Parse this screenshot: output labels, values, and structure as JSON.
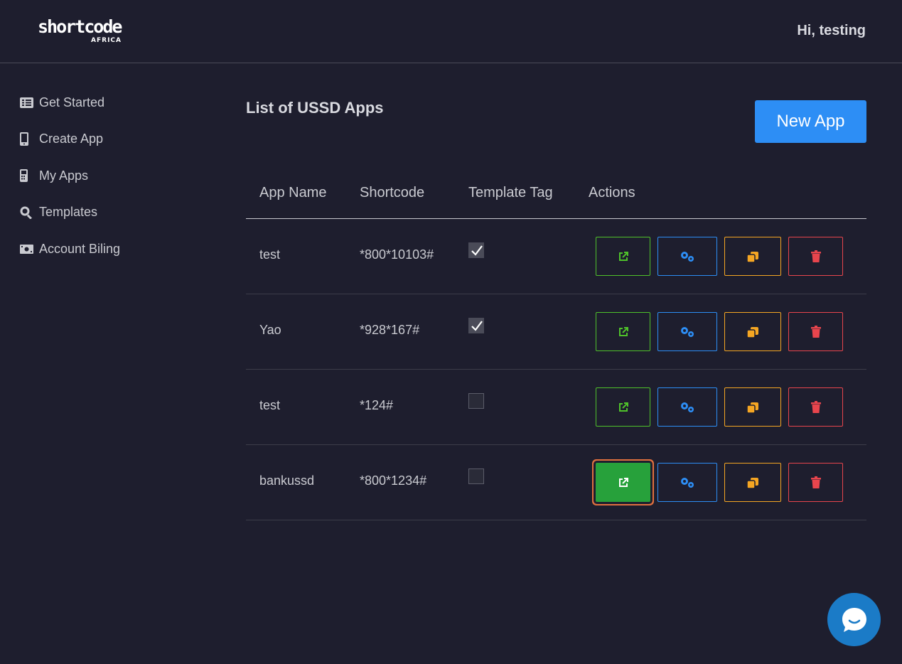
{
  "brand": {
    "logo_text": "shortcode",
    "logo_sub": "AFRICA"
  },
  "header": {
    "greeting": "Hi, testing"
  },
  "sidebar": {
    "items": [
      {
        "label": "Get Started",
        "icon": "list-icon"
      },
      {
        "label": "Create App",
        "icon": "mobile-icon"
      },
      {
        "label": "My Apps",
        "icon": "phone-icon"
      },
      {
        "label": "Templates",
        "icon": "search-icon"
      },
      {
        "label": "Account Biling",
        "icon": "money-icon"
      }
    ]
  },
  "main": {
    "title": "List of USSD Apps",
    "new_app_label": "New App",
    "columns": [
      "App Name",
      "Shortcode",
      "Template Tag",
      "Actions"
    ],
    "rows": [
      {
        "name": "test",
        "shortcode": "*800*10103#",
        "template": true
      },
      {
        "name": "Yao",
        "shortcode": "*928*167#",
        "template": true
      },
      {
        "name": "test",
        "shortcode": "*124#",
        "template": false
      },
      {
        "name": "bankussd",
        "shortcode": "*800*1234#",
        "template": false
      }
    ]
  },
  "colors": {
    "open": "#4fc22a",
    "config": "#2d8ef5",
    "duplicate": "#f5a623",
    "delete": "#e8454d",
    "primary": "#2d8ef5"
  }
}
